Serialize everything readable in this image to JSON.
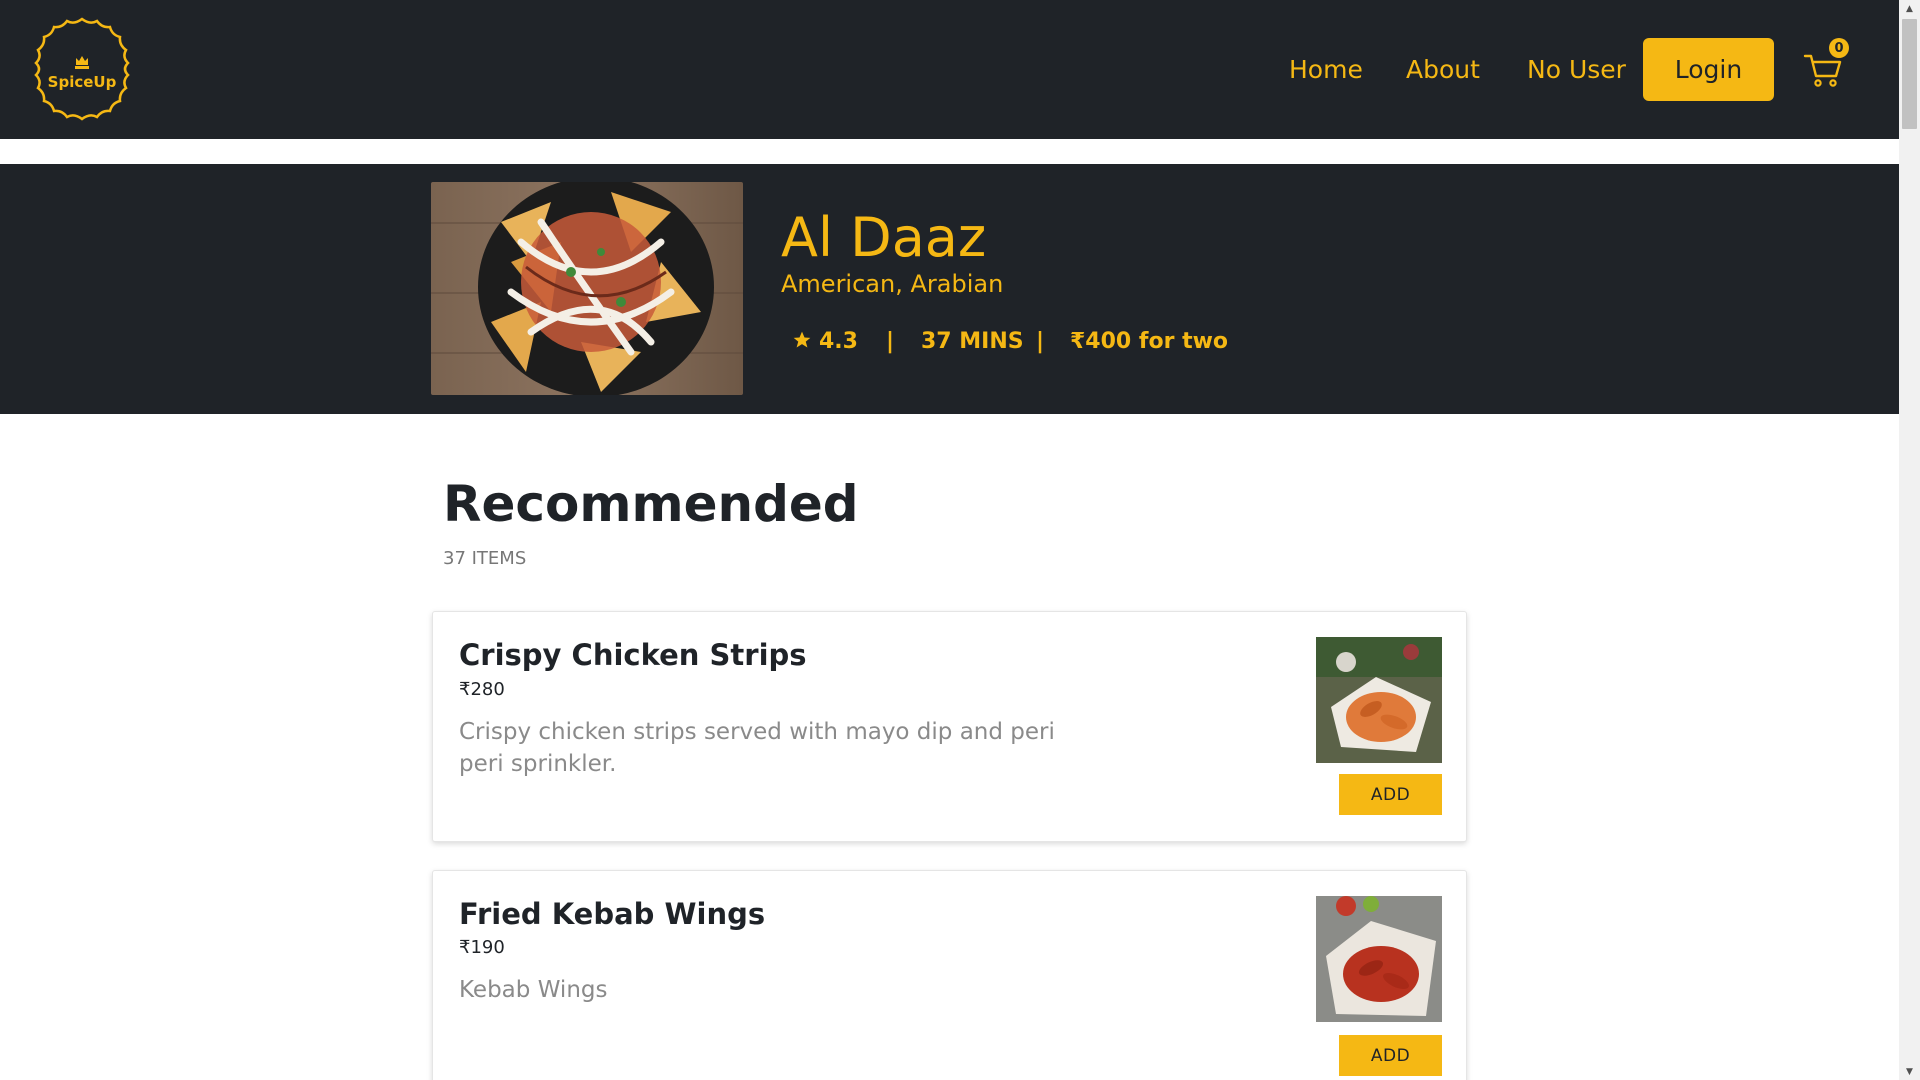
{
  "brand": {
    "logo_text": "SpiceUp"
  },
  "nav": {
    "links": [
      "Home",
      "About",
      "No User"
    ],
    "login_label": "Login",
    "cart_count": "0"
  },
  "restaurant": {
    "name": "Al Daaz",
    "cuisine": "American, Arabian",
    "rating": "4.3",
    "separator": "|",
    "delivery_time": "37 MINS",
    "cost_for_two": "₹400 for two"
  },
  "menu": {
    "section_title": "Recommended",
    "item_count": "37 ITEMS",
    "items": [
      {
        "name": "Crispy Chicken Strips",
        "price": "₹280",
        "description": "Crispy chicken strips served with mayo dip and peri peri sprinkler.",
        "add_label": "ADD"
      },
      {
        "name": "Fried Kebab Wings",
        "price": "₹190",
        "description": "Kebab Wings",
        "add_label": "ADD"
      }
    ]
  },
  "colors": {
    "accent": "#f5b814",
    "dark": "#1f2328"
  }
}
